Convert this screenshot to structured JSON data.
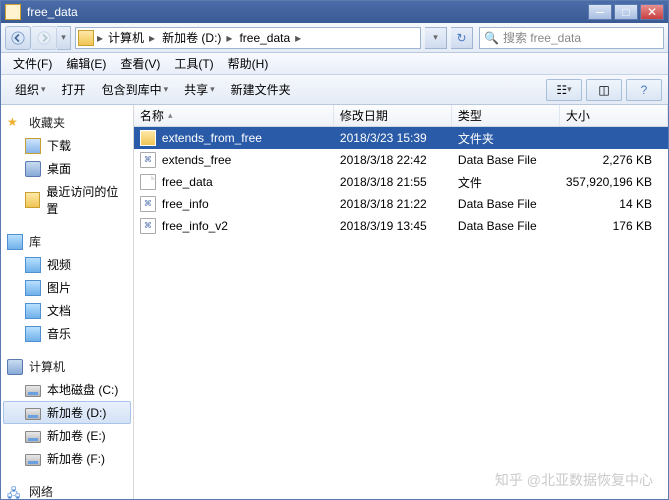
{
  "window": {
    "title": "free_data"
  },
  "breadcrumb": {
    "seg1": "计算机",
    "seg2": "新加卷 (D:)",
    "seg3": "free_data"
  },
  "search": {
    "placeholder": "搜索 free_data"
  },
  "menu": {
    "file": "文件(F)",
    "edit": "编辑(E)",
    "view": "查看(V)",
    "tools": "工具(T)",
    "help": "帮助(H)"
  },
  "toolbar": {
    "organize": "组织",
    "open": "打开",
    "include": "包含到库中",
    "share": "共享",
    "newfolder": "新建文件夹"
  },
  "sidebar": {
    "favorites": "收藏夹",
    "fav_items": {
      "downloads": "下载",
      "desktop": "桌面",
      "recent": "最近访问的位置"
    },
    "libraries": "库",
    "lib_items": {
      "videos": "视频",
      "pictures": "图片",
      "documents": "文档",
      "music": "音乐"
    },
    "computer": "计算机",
    "drives": {
      "c": "本地磁盘 (C:)",
      "d": "新加卷 (D:)",
      "e": "新加卷 (E:)",
      "f": "新加卷 (F:)"
    },
    "network": "网络"
  },
  "columns": {
    "name": "名称",
    "date": "修改日期",
    "type": "类型",
    "size": "大小"
  },
  "rows": [
    {
      "name": "extends_from_free",
      "date": "2018/3/23 15:39",
      "type": "文件夹",
      "size": "",
      "kind": "folder",
      "selected": true
    },
    {
      "name": "extends_free",
      "date": "2018/3/18 22:42",
      "type": "Data Base File",
      "size": "2,276 KB",
      "kind": "db"
    },
    {
      "name": "free_data",
      "date": "2018/3/18 21:55",
      "type": "文件",
      "size": "357,920,196 KB",
      "kind": "file"
    },
    {
      "name": "free_info",
      "date": "2018/3/18 21:22",
      "type": "Data Base File",
      "size": "14 KB",
      "kind": "db"
    },
    {
      "name": "free_info_v2",
      "date": "2018/3/19 13:45",
      "type": "Data Base File",
      "size": "176 KB",
      "kind": "db"
    }
  ],
  "watermark": "知乎 @北亚数据恢复中心"
}
